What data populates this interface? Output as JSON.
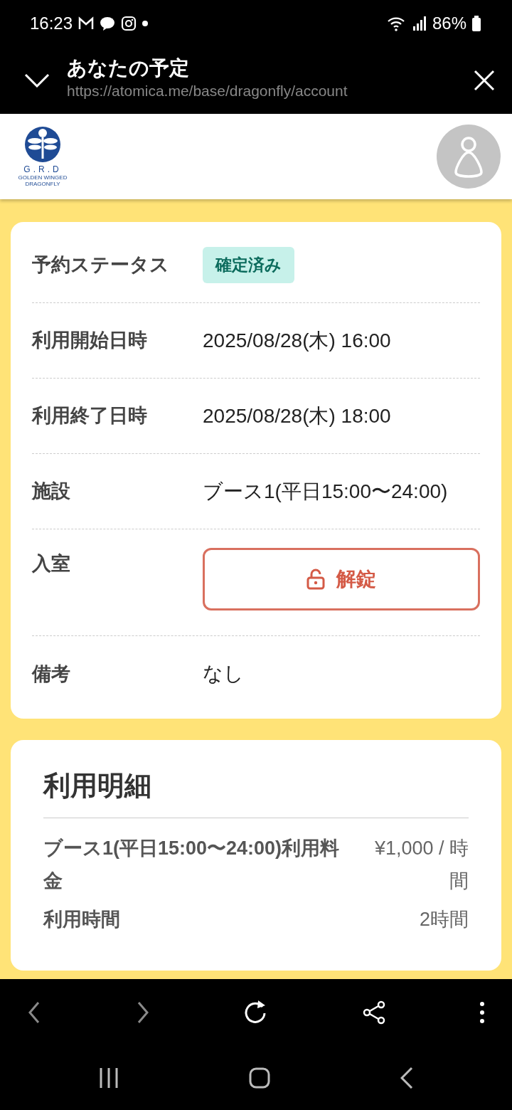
{
  "status_bar": {
    "time": "16:23",
    "battery": "86%"
  },
  "browser": {
    "title": "あなたの予定",
    "url": "https://atomica.me/base/dragonfly/account"
  },
  "site_header": {
    "logo_text": "G.R.D",
    "logo_tagline": "GOLDEN WINGED DRAGONFLY"
  },
  "reservation": [
    {
      "kind": "badge",
      "label": "予約ステータス",
      "value": "確定済み"
    },
    {
      "kind": "text",
      "label": "利用開始日時",
      "value": "2025/08/28(木) 16:00"
    },
    {
      "kind": "text",
      "label": "利用終了日時",
      "value": "2025/08/28(木) 18:00"
    },
    {
      "kind": "text",
      "label": "施設",
      "value": "ブース1(平日15:00〜24:00)"
    },
    {
      "kind": "button",
      "label": "入室",
      "value": "解錠"
    },
    {
      "kind": "text",
      "label": "備考",
      "value": "なし"
    }
  ],
  "details": {
    "title": "利用明細",
    "items": [
      {
        "label": "ブース1(平日15:00〜24:00)利用料金",
        "value": "¥1,000 / 時間"
      },
      {
        "label": "利用時間",
        "value": "2時間"
      }
    ]
  },
  "browser_toolbar": [
    {
      "kind": "back",
      "disabled": true
    },
    {
      "kind": "forward",
      "disabled": true
    },
    {
      "kind": "reload",
      "disabled": false
    },
    {
      "kind": "share",
      "disabled": false
    },
    {
      "kind": "more",
      "disabled": false
    }
  ]
}
